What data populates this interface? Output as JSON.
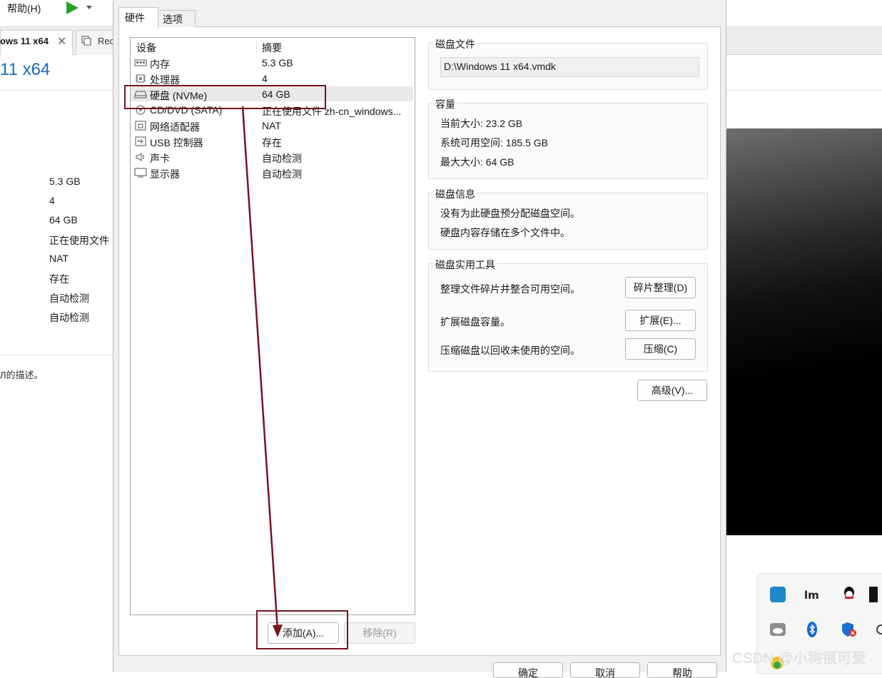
{
  "main_window": {
    "menu_help": "帮助(H)",
    "vm_tab_label": "ows 11 x64",
    "second_tab_label": "Rec",
    "vm_title": "11 x64",
    "summary_values": [
      "5.3 GB",
      "4",
      "64 GB",
      "正在使用文件",
      "NAT",
      "存在",
      "自动检测",
      "自动检测"
    ],
    "description_fragment": "Л的描述。"
  },
  "dialog": {
    "tabs": [
      {
        "label": "硬件",
        "active": true
      },
      {
        "label": "选项",
        "active": false
      }
    ],
    "device_list": {
      "headers": {
        "device": "设备",
        "summary": "摘要"
      },
      "rows": [
        {
          "icon": "memory-icon",
          "name": "内存",
          "summary": "5.3 GB"
        },
        {
          "icon": "processor-icon",
          "name": "处理器",
          "summary": "4"
        },
        {
          "icon": "harddisk-icon",
          "name": "硬盘 (NVMe)",
          "summary": "64 GB",
          "selected": true
        },
        {
          "icon": "cd-dvd-icon",
          "name": "CD/DVD (SATA)",
          "summary": "正在使用文件 zh-cn_windows..."
        },
        {
          "icon": "network-adapter-icon",
          "name": "网络适配器",
          "summary": "NAT"
        },
        {
          "icon": "usb-icon",
          "name": "USB 控制器",
          "summary": "存在"
        },
        {
          "icon": "sound-card-icon",
          "name": "声卡",
          "summary": "自动检测"
        },
        {
          "icon": "display-icon",
          "name": "显示器",
          "summary": "自动检测"
        }
      ]
    },
    "add_button": "添加(A)...",
    "remove_button": "移除(R)",
    "disk_file": {
      "title": "磁盘文件",
      "path": "D:\\Windows 11 x64.vmdk"
    },
    "capacity": {
      "title": "容量",
      "current_size": "当前大小: 23.2 GB",
      "available_space": "系统可用空间: 185.5 GB",
      "max_size": "最大大小: 64 GB"
    },
    "disk_info": {
      "title": "磁盘信息",
      "line1": "没有为此硬盘预分配磁盘空间。",
      "line2": "硬盘内容存储在多个文件中。"
    },
    "disk_utilities": {
      "title": "磁盘实用工具",
      "defrag_text": "整理文件碎片并整合可用空间。",
      "defrag_button": "碎片整理(D)",
      "expand_text": "扩展磁盘容量。",
      "expand_button": "扩展(E)...",
      "compact_text": "压缩磁盘以回收未使用的空间。",
      "compact_button": "压缩(C)"
    },
    "advanced_button": "高级(V)...",
    "footer_buttons": {
      "ok": "确定",
      "cancel": "取消",
      "help": "帮助"
    }
  },
  "watermark": "CSDN @小狗很可爱",
  "colors": {
    "annotation": "#7a1322",
    "play": "#2aa12a",
    "title_blue": "#1a6bc0"
  }
}
